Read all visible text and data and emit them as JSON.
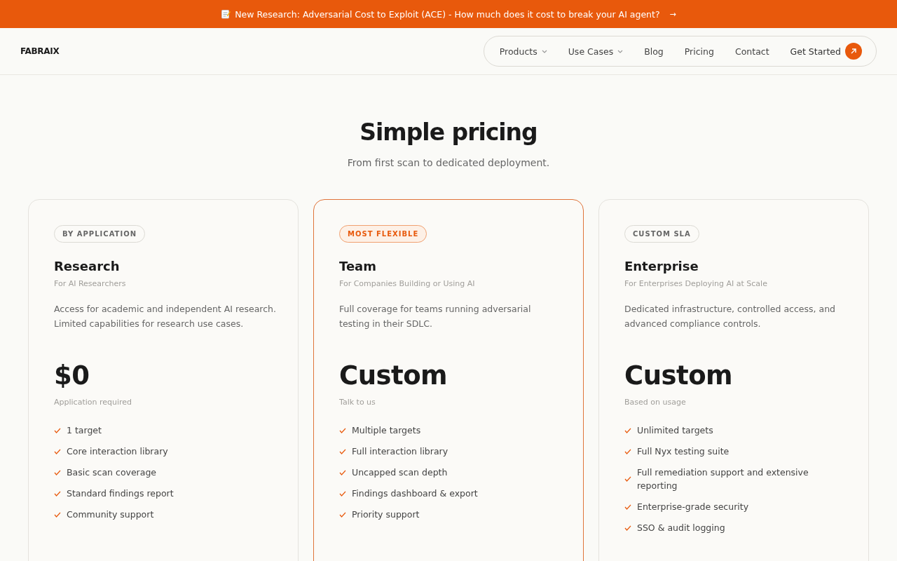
{
  "banner": {
    "text": "New Research: Adversarial Cost to Exploit (ACE) - How much does it cost to break your AI agent?",
    "arrow": "→"
  },
  "header": {
    "logo": "FABRAIX",
    "nav": [
      {
        "label": "Products",
        "has_menu": true
      },
      {
        "label": "Use Cases",
        "has_menu": true
      },
      {
        "label": "Blog",
        "has_menu": false
      },
      {
        "label": "Pricing",
        "has_menu": false
      },
      {
        "label": "Contact",
        "has_menu": false
      }
    ],
    "cta": "Get Started"
  },
  "hero": {
    "title": "Simple pricing",
    "subtitle": "From first scan to dedicated deployment."
  },
  "plans": [
    {
      "badge": "BY APPLICATION",
      "featured": false,
      "name": "Research",
      "audience": "For AI Researchers",
      "description": "Access for academic and independent AI research. Limited capabilities for research use cases.",
      "price": "$0",
      "price_note": "Application required",
      "features": [
        "1 target",
        "Core interaction library",
        "Basic scan coverage",
        "Standard findings report",
        "Community support"
      ]
    },
    {
      "badge": "MOST FLEXIBLE",
      "featured": true,
      "name": "Team",
      "audience": "For Companies Building or Using AI",
      "description": "Full coverage for teams running adversarial testing in their SDLC.",
      "price": "Custom",
      "price_note": "Talk to us",
      "features": [
        "Multiple targets",
        "Full interaction library",
        "Uncapped scan depth",
        "Findings dashboard & export",
        "Priority support"
      ]
    },
    {
      "badge": "CUSTOM SLA",
      "featured": false,
      "name": "Enterprise",
      "audience": "For Enterprises Deploying AI at Scale",
      "description": "Dedicated infrastructure, controlled access, and advanced compliance controls.",
      "price": "Custom",
      "price_note": "Based on usage",
      "features": [
        "Unlimited targets",
        "Full Nyx testing suite",
        "Full remediation support and extensive reporting",
        "Enterprise-grade security",
        "SSO & audit logging"
      ]
    }
  ]
}
